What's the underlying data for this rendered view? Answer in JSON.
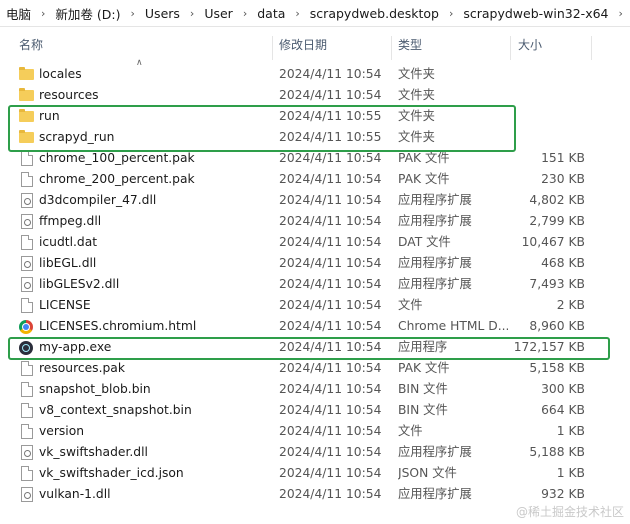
{
  "breadcrumb": {
    "items": [
      "电脑",
      "新加卷 (D:)",
      "Users",
      "User",
      "data",
      "scrapydweb.desktop",
      "scrapydweb-win32-x64"
    ]
  },
  "columns": {
    "name": "名称",
    "date": "修改日期",
    "type": "类型",
    "size": "大小"
  },
  "files": [
    {
      "name": "locales",
      "date": "2024/4/11 10:54",
      "type": "文件夹",
      "size": "",
      "icon": "folder-icon"
    },
    {
      "name": "resources",
      "date": "2024/4/11 10:54",
      "type": "文件夹",
      "size": "",
      "icon": "folder-icon"
    },
    {
      "name": "run",
      "date": "2024/4/11 10:55",
      "type": "文件夹",
      "size": "",
      "icon": "folder-icon"
    },
    {
      "name": "scrapyd_run",
      "date": "2024/4/11 10:55",
      "type": "文件夹",
      "size": "",
      "icon": "folder-icon"
    },
    {
      "name": "chrome_100_percent.pak",
      "date": "2024/4/11 10:54",
      "type": "PAK 文件",
      "size": "151 KB",
      "icon": "file-icon"
    },
    {
      "name": "chrome_200_percent.pak",
      "date": "2024/4/11 10:54",
      "type": "PAK 文件",
      "size": "230 KB",
      "icon": "file-icon"
    },
    {
      "name": "d3dcompiler_47.dll",
      "date": "2024/4/11 10:54",
      "type": "应用程序扩展",
      "size": "4,802 KB",
      "icon": "dll-icon"
    },
    {
      "name": "ffmpeg.dll",
      "date": "2024/4/11 10:54",
      "type": "应用程序扩展",
      "size": "2,799 KB",
      "icon": "dll-icon"
    },
    {
      "name": "icudtl.dat",
      "date": "2024/4/11 10:54",
      "type": "DAT 文件",
      "size": "10,467 KB",
      "icon": "file-icon"
    },
    {
      "name": "libEGL.dll",
      "date": "2024/4/11 10:54",
      "type": "应用程序扩展",
      "size": "468 KB",
      "icon": "dll-icon"
    },
    {
      "name": "libGLESv2.dll",
      "date": "2024/4/11 10:54",
      "type": "应用程序扩展",
      "size": "7,493 KB",
      "icon": "dll-icon"
    },
    {
      "name": "LICENSE",
      "date": "2024/4/11 10:54",
      "type": "文件",
      "size": "2 KB",
      "icon": "file-icon"
    },
    {
      "name": "LICENSES.chromium.html",
      "date": "2024/4/11 10:54",
      "type": "Chrome HTML D...",
      "size": "8,960 KB",
      "icon": "chrome-icon"
    },
    {
      "name": "my-app.exe",
      "date": "2024/4/11 10:54",
      "type": "应用程序",
      "size": "172,157 KB",
      "icon": "electron-icon"
    },
    {
      "name": "resources.pak",
      "date": "2024/4/11 10:54",
      "type": "PAK 文件",
      "size": "5,158 KB",
      "icon": "file-icon"
    },
    {
      "name": "snapshot_blob.bin",
      "date": "2024/4/11 10:54",
      "type": "BIN 文件",
      "size": "300 KB",
      "icon": "file-icon"
    },
    {
      "name": "v8_context_snapshot.bin",
      "date": "2024/4/11 10:54",
      "type": "BIN 文件",
      "size": "664 KB",
      "icon": "file-icon"
    },
    {
      "name": "version",
      "date": "2024/4/11 10:54",
      "type": "文件",
      "size": "1 KB",
      "icon": "file-icon"
    },
    {
      "name": "vk_swiftshader.dll",
      "date": "2024/4/11 10:54",
      "type": "应用程序扩展",
      "size": "5,188 KB",
      "icon": "dll-icon"
    },
    {
      "name": "vk_swiftshader_icd.json",
      "date": "2024/4/11 10:54",
      "type": "JSON 文件",
      "size": "1 KB",
      "icon": "file-icon"
    },
    {
      "name": "vulkan-1.dll",
      "date": "2024/4/11 10:54",
      "type": "应用程序扩展",
      "size": "932 KB",
      "icon": "dll-icon"
    }
  ],
  "watermark": "@稀土掘金技术社区",
  "colors": {
    "highlight": "#2e9e4a",
    "header_text": "#4a5a6f",
    "folder": "#f5cd5a"
  }
}
